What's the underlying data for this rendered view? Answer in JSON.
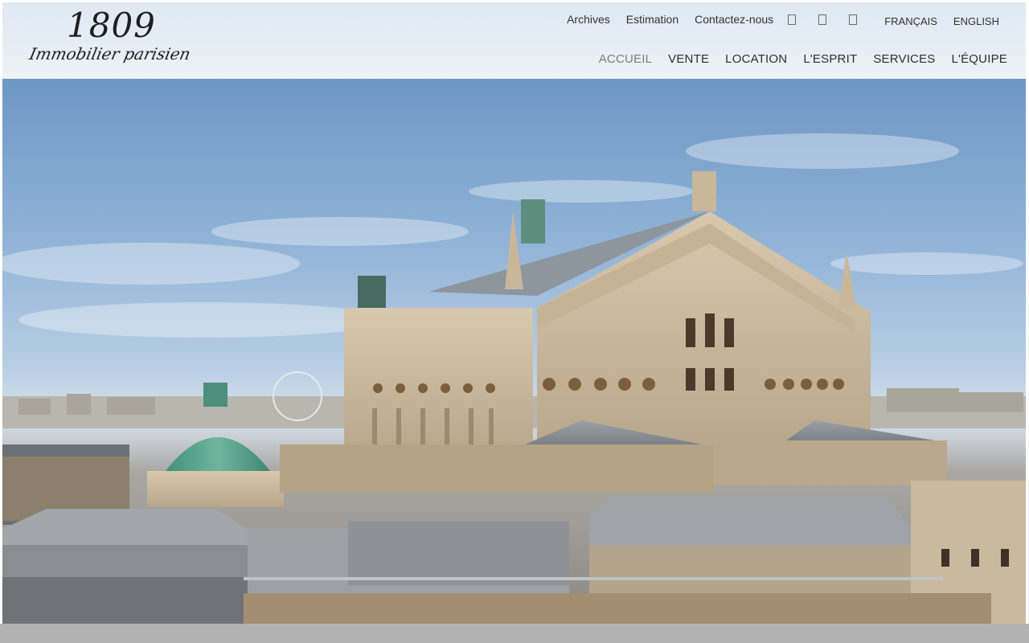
{
  "header": {
    "logo": {
      "number": "1809",
      "tagline": "Immobilier parisien"
    },
    "utility_links": [
      "Archives",
      "Estimation",
      "Contactez-nous"
    ],
    "social_icons": [
      "social-icon-1",
      "social-icon-2",
      "social-icon-3"
    ],
    "languages": [
      "FRANÇAIS",
      "ENGLISH"
    ],
    "main_nav": [
      {
        "label": "ACCUEIL",
        "active": true
      },
      {
        "label": "VENTE",
        "active": false
      },
      {
        "label": "LOCATION",
        "active": false
      },
      {
        "label": "L'ESPRIT",
        "active": false
      },
      {
        "label": "SERVICES",
        "active": false
      },
      {
        "label": "L'ÉQUIPE",
        "active": false
      }
    ]
  },
  "hero": {
    "image": "palais-garnier-opera-rooftop-photo"
  },
  "colors": {
    "header_bg": "#e6eef5",
    "nav_text": "#2c2f36",
    "nav_active": "#7a7d83",
    "footer_bar": "#b3b3b3"
  }
}
